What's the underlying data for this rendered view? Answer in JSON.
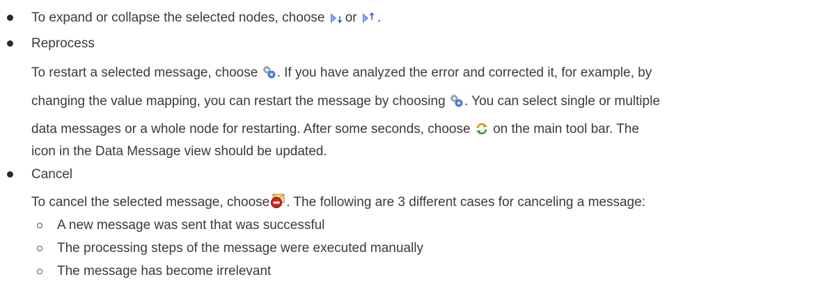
{
  "items": [
    {
      "pre": "To expand or collapse the selected nodes, choose",
      "mid": "or",
      "post": ".",
      "icons": [
        "expand-nodes-icon",
        "collapse-nodes-icon"
      ]
    },
    {
      "title": "Reprocess",
      "lines": [
        {
          "pre": "To restart a selected message, choose",
          "post": ". If you have analyzed the error and corrected it, for example, by",
          "icon": "gears-icon"
        },
        {
          "pre": "changing the value mapping, you can restart the message by choosing",
          "post": ". You can select single or multiple",
          "icon": "gears-icon"
        },
        {
          "pre": "data messages or a whole node for restarting. After some seconds, choose",
          "post": " on the main tool bar. The",
          "icon": "refresh-icon"
        },
        {
          "text": "icon in the Data Message view should be updated."
        }
      ]
    },
    {
      "title": "Cancel",
      "lines": [
        {
          "pre": "To cancel the selected message, choose",
          "post": ". The following are 3 different cases for canceling a message:",
          "icon": "cancel-message-icon"
        }
      ],
      "subitems": [
        "A new message was sent that was successful",
        "The processing steps of the message were executed manually",
        "The message has become irrelevant"
      ]
    }
  ]
}
